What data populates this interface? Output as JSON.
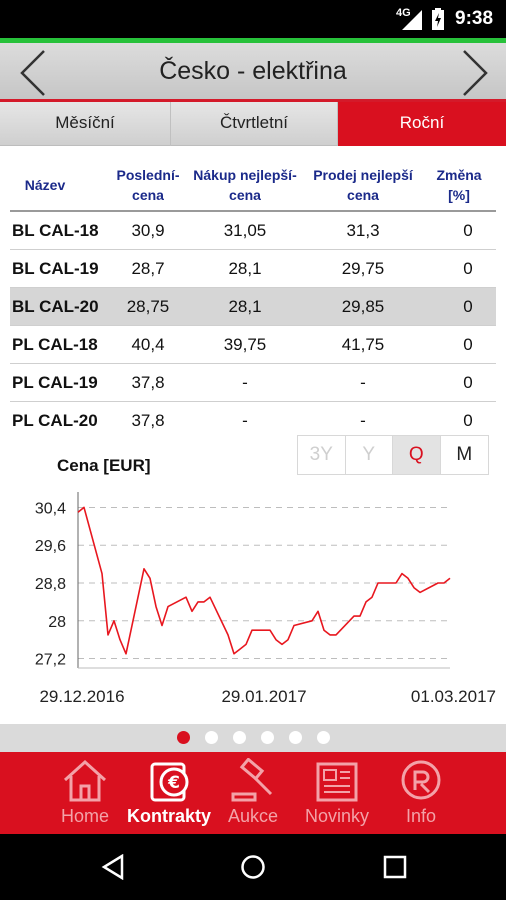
{
  "status": {
    "network": "4G",
    "time": "9:38"
  },
  "header": {
    "title": "Česko - elektřina"
  },
  "tabs": [
    {
      "label": "Měsíční",
      "active": false
    },
    {
      "label": "Čtvrtletní",
      "active": false
    },
    {
      "label": "Roční",
      "active": true
    }
  ],
  "table": {
    "columns": [
      "Název",
      "Poslední-cena",
      "Nákup nejlepší-cena",
      "Prodej nejlepší cena",
      "Změna [%]"
    ],
    "column_lines": [
      [
        "Název"
      ],
      [
        "Poslední-",
        "cena"
      ],
      [
        "Nákup nejlepší-",
        "cena"
      ],
      [
        "Prodej nejlepší",
        "cena"
      ],
      [
        "Změna",
        "[%]"
      ]
    ],
    "rows": [
      {
        "name": "BL CAL-18",
        "last": "30,9",
        "buy": "31,05",
        "sell": "31,3",
        "change": "0"
      },
      {
        "name": "BL CAL-19",
        "last": "28,7",
        "buy": "28,1",
        "sell": "29,75",
        "change": "0"
      },
      {
        "name": "BL CAL-20",
        "last": "28,75",
        "buy": "28,1",
        "sell": "29,85",
        "change": "0",
        "selected": true
      },
      {
        "name": "PL CAL-18",
        "last": "40,4",
        "buy": "39,75",
        "sell": "41,75",
        "change": "0"
      },
      {
        "name": "PL CAL-19",
        "last": "37,8",
        "buy": "-",
        "sell": "-",
        "change": "0"
      },
      {
        "name": "PL CAL-20",
        "last": "37,8",
        "buy": "-",
        "sell": "-",
        "change": "0"
      }
    ]
  },
  "ranges": [
    {
      "label": "3Y",
      "state": "disabled"
    },
    {
      "label": "Y",
      "state": "disabled"
    },
    {
      "label": "Q",
      "state": "active"
    },
    {
      "label": "M",
      "state": "normal"
    }
  ],
  "chart": {
    "title": "Cena [EUR]"
  },
  "chart_data": {
    "type": "line",
    "title": "",
    "ylabel": "Cena [EUR]",
    "xlabel": "",
    "x_tick_labels": [
      "29.12.2016",
      "29.01.2017",
      "01.03.2017"
    ],
    "x_range": [
      "2016-12-29",
      "2017-03-01"
    ],
    "y_ticks": [
      27.2,
      28,
      28.8,
      29.6,
      30.4
    ],
    "y_tick_labels": [
      "27,2",
      "28",
      "28,8",
      "29,6",
      "30,4"
    ],
    "ylim": [
      27.0,
      30.6
    ],
    "grid": "horizontal dashed",
    "color": "#e8171f",
    "series": [
      {
        "x": [
          "2016-12-29",
          "2016-12-30",
          "2017-01-02",
          "2017-01-03",
          "2017-01-04",
          "2017-01-05",
          "2017-01-06",
          "2017-01-09",
          "2017-01-10",
          "2017-01-11",
          "2017-01-12",
          "2017-01-13",
          "2017-01-16",
          "2017-01-17",
          "2017-01-18",
          "2017-01-19",
          "2017-01-20",
          "2017-01-23",
          "2017-01-24",
          "2017-01-25",
          "2017-01-26",
          "2017-01-27",
          "2017-01-30",
          "2017-01-31",
          "2017-02-01",
          "2017-02-02",
          "2017-02-03",
          "2017-02-06",
          "2017-02-07",
          "2017-02-08",
          "2017-02-09",
          "2017-02-10",
          "2017-02-13",
          "2017-02-14",
          "2017-02-15",
          "2017-02-16",
          "2017-02-17",
          "2017-02-20",
          "2017-02-21",
          "2017-02-22",
          "2017-02-23",
          "2017-02-24",
          "2017-02-27",
          "2017-02-28",
          "2017-03-01"
        ],
        "values": [
          30.3,
          30.4,
          29.0,
          27.7,
          28.0,
          27.6,
          27.3,
          29.1,
          28.9,
          28.3,
          27.9,
          28.3,
          28.5,
          28.2,
          28.4,
          28.4,
          28.5,
          27.7,
          27.3,
          27.4,
          27.5,
          27.8,
          27.8,
          27.6,
          27.5,
          27.6,
          27.9,
          28.0,
          28.2,
          27.8,
          27.7,
          27.7,
          28.1,
          28.1,
          28.4,
          28.5,
          28.8,
          28.8,
          29.0,
          28.9,
          28.7,
          28.6,
          28.8,
          28.8,
          28.9
        ]
      }
    ]
  },
  "pager": {
    "count": 6,
    "active": 0
  },
  "bottom_nav": [
    {
      "label": "Home",
      "icon": "home-icon",
      "active": false
    },
    {
      "label": "Kontrakty",
      "icon": "contracts-euro-icon",
      "active": true
    },
    {
      "label": "Aukce",
      "icon": "gavel-icon",
      "active": false
    },
    {
      "label": "Novinky",
      "icon": "newspaper-icon",
      "active": false
    },
    {
      "label": "Info",
      "icon": "info-badge-icon",
      "active": false
    }
  ],
  "system_nav": {
    "icons": [
      "back-icon",
      "home-circle-icon",
      "recents-icon"
    ]
  }
}
